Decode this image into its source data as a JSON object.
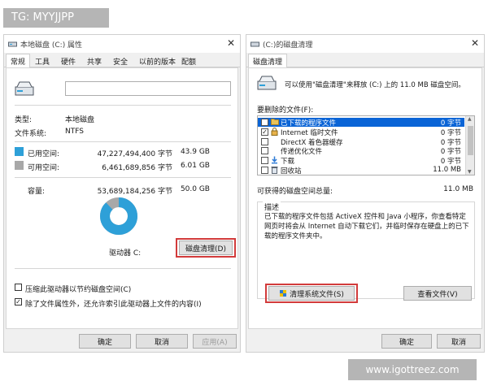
{
  "watermark_top": "TG: MYYJJPP",
  "watermark_bottom": "www.igottreez.com",
  "props": {
    "title": "本地磁盘 (C:) 属性",
    "tabs": [
      "常规",
      "工具",
      "硬件",
      "共享",
      "安全",
      "以前的版本",
      "配额"
    ],
    "type_label": "类型:",
    "type_value": "本地磁盘",
    "fs_label": "文件系统:",
    "fs_value": "NTFS",
    "used_label": "已用空间:",
    "used_bytes": "47,227,494,400 字节",
    "used_gb": "43.9 GB",
    "free_label": "可用空间:",
    "free_bytes": "6,461,689,856 字节",
    "free_gb": "6.01 GB",
    "cap_label": "容量:",
    "cap_bytes": "53,689,184,256 字节",
    "cap_gb": "50.0 GB",
    "drive_label": "驱动器 C:",
    "cleanup_button": "磁盘清理(D)",
    "compress_label": "压缩此驱动器以节约磁盘空间(C)",
    "index_label": "除了文件属性外，还允许索引此驱动器上文件的内容(I)",
    "ok": "确定",
    "cancel": "取消",
    "apply": "应用(A)",
    "used_fraction": 0.879,
    "used_color": "#2ea0d8",
    "free_color": "#a8a8a8"
  },
  "cleanup": {
    "title": "(C:)的磁盘清理",
    "tab": "磁盘清理",
    "intro": "可以使用\"磁盘清理\"来释放 (C:) 上的 11.0 MB 磁盘空间。",
    "files_label": "要删除的文件(F):",
    "items": [
      {
        "name": "已下载的程序文件",
        "size": "0 字节",
        "checked": true,
        "icon": "folder-icon"
      },
      {
        "name": "Internet 临时文件",
        "size": "0 字节",
        "checked": true,
        "icon": "lock-icon"
      },
      {
        "name": "DirectX 着色器缓存",
        "size": "0 字节",
        "checked": false,
        "icon": "blank-icon"
      },
      {
        "name": "传递优化文件",
        "size": "0 字节",
        "checked": false,
        "icon": "blank-icon"
      },
      {
        "name": "下载",
        "size": "0 字节",
        "checked": false,
        "icon": "download-icon"
      },
      {
        "name": "回收站",
        "size": "11.0 MB",
        "checked": false,
        "icon": "recycle-bin-icon"
      }
    ],
    "gain_label": "可获得的磁盘空间总量:",
    "gain_value": "11.0 MB",
    "desc_label": "描述",
    "desc_text": "已下载的程序文件包括 ActiveX 控件和 Java 小程序，你查看特定网页时将会从 Internet 自动下载它们，并临时保存在硬盘上的已下载的程序文件夹中。",
    "sys_button": "清理系统文件(S)",
    "view_button": "查看文件(V)",
    "ok": "确定",
    "cancel": "取消"
  }
}
